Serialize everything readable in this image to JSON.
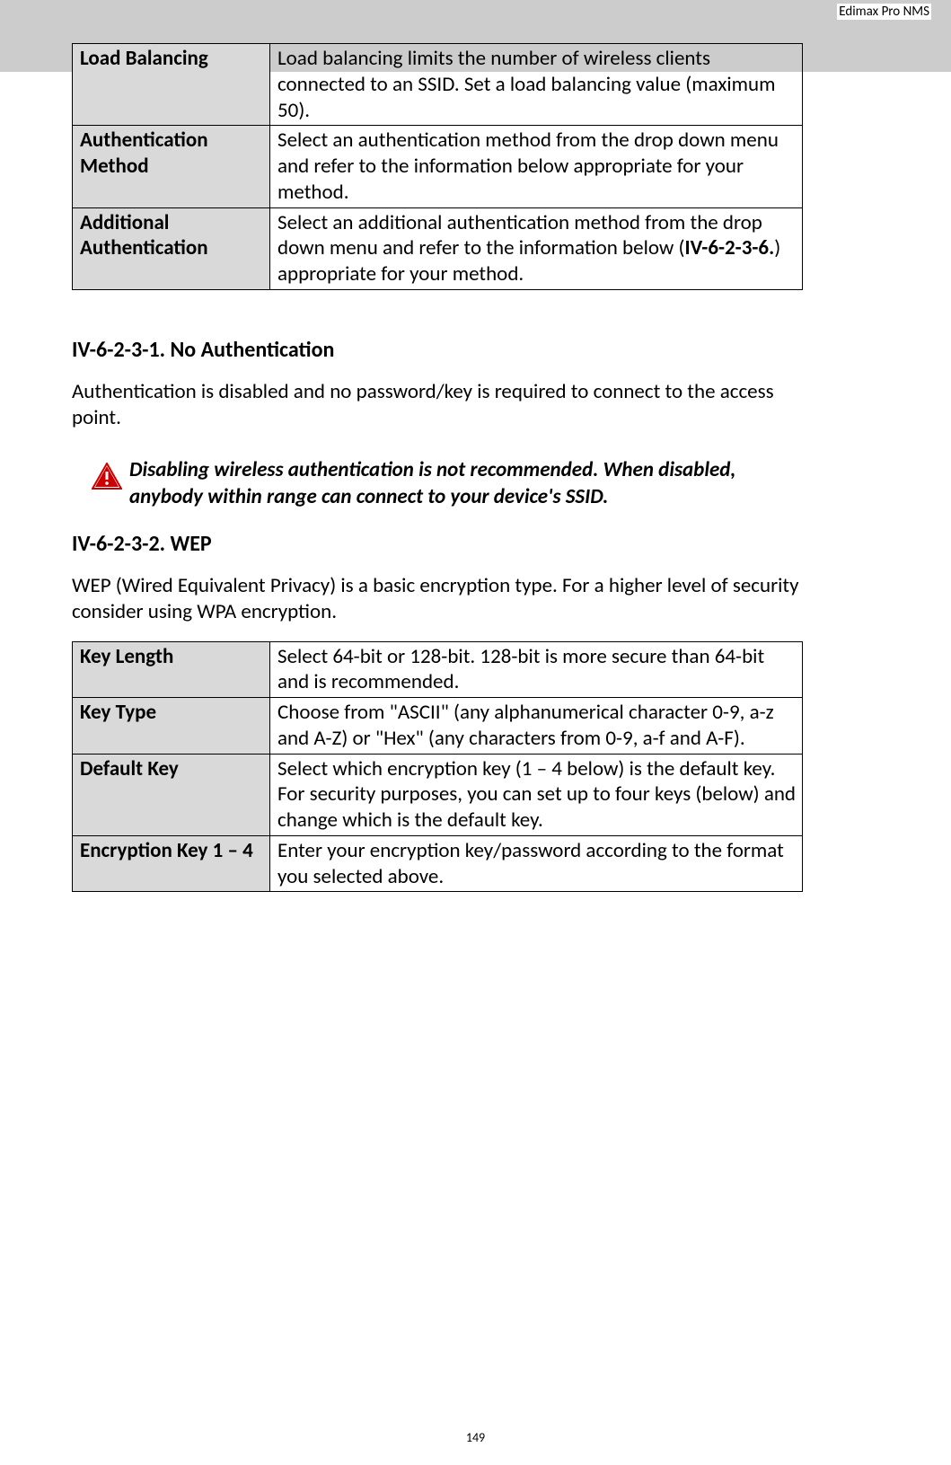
{
  "header": "Edimax Pro NMS",
  "page_number": "149",
  "table1": {
    "rows": [
      {
        "label": "Load Balancing",
        "desc": "Load balancing limits the number of wireless clients connected to an SSID. Set a load balancing value (maximum 50)."
      },
      {
        "label": "Authentication Method",
        "desc": "Select an authentication method from the drop down menu and refer to the information below appropriate for your method."
      },
      {
        "label": "Additional Authentication",
        "desc_before": "Select an additional authentication method from the drop down menu and refer to the information below (",
        "desc_bold": "IV-6-2-3-6.",
        "desc_after": ") appropriate for your method."
      }
    ]
  },
  "section1": {
    "heading": "IV-6-2-3-1. No Authentication",
    "paragraph": "Authentication is disabled and no password/key is required to connect to the access point.",
    "warning": "Disabling wireless authentication is not recommended. When disabled, anybody within range can connect to your device's SSID."
  },
  "section2": {
    "heading": "IV-6-2-3-2. WEP",
    "paragraph": "WEP (Wired Equivalent Privacy) is a basic encryption type. For a higher level of security consider using WPA encryption."
  },
  "table2": {
    "rows": [
      {
        "label": "Key Length",
        "desc": "Select 64-bit or 128-bit. 128-bit is more secure than 64-bit and is recommended."
      },
      {
        "label": "Key Type",
        "desc": "Choose from \"ASCII\" (any alphanumerical character 0-9, a-z and A-Z) or \"Hex\" (any characters from 0-9, a-f and A-F)."
      },
      {
        "label": "Default Key",
        "desc": "Select which encryption key (1 – 4 below) is the default key. For security purposes, you can set up to four keys (below) and change which is the default key."
      },
      {
        "label": "Encryption Key 1 – 4",
        "desc": "Enter your encryption key/password according to the format you selected above."
      }
    ]
  }
}
